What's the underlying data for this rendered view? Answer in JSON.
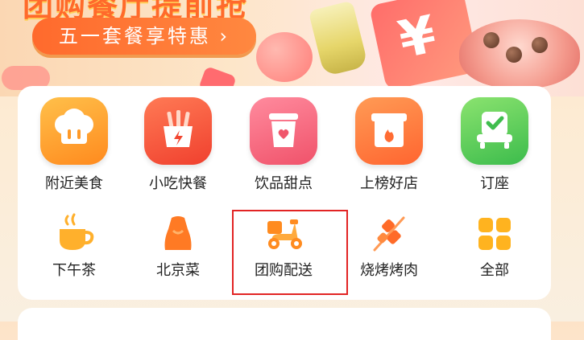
{
  "banner": {
    "headline": "团购餐厅提前抢",
    "promo_button": "五一套餐享特惠 ›"
  },
  "deco": {
    "yen": "¥"
  },
  "categories_row1": [
    {
      "label": "附近美食",
      "icon": "chef-hat-icon",
      "color": "#ff9a28"
    },
    {
      "label": "小吃快餐",
      "icon": "fries-icon",
      "color": "#f2452f"
    },
    {
      "label": "饮品甜点",
      "icon": "drink-cup-icon",
      "color": "#f0566c"
    },
    {
      "label": "上榜好店",
      "icon": "flame-badge-icon",
      "color": "#ff6c33"
    },
    {
      "label": "订座",
      "icon": "armchair-check-icon",
      "color": "#3fbd4d"
    }
  ],
  "categories_row2": [
    {
      "label": "下午茶",
      "icon": "coffee-cup-icon",
      "color": "#ffb02c"
    },
    {
      "label": "北京菜",
      "icon": "roast-duck-icon",
      "color": "#ff7a24"
    },
    {
      "label": "团购配送",
      "icon": "scooter-icon",
      "color": "#ff8b1f"
    },
    {
      "label": "烧烤烤肉",
      "icon": "skewer-icon",
      "color": "#ff6b28"
    },
    {
      "label": "全部",
      "icon": "grid-icon",
      "color": "#ffb31f"
    }
  ],
  "colors": {
    "highlight_border": "#e22424",
    "promo_button": "#ff6a2d"
  }
}
